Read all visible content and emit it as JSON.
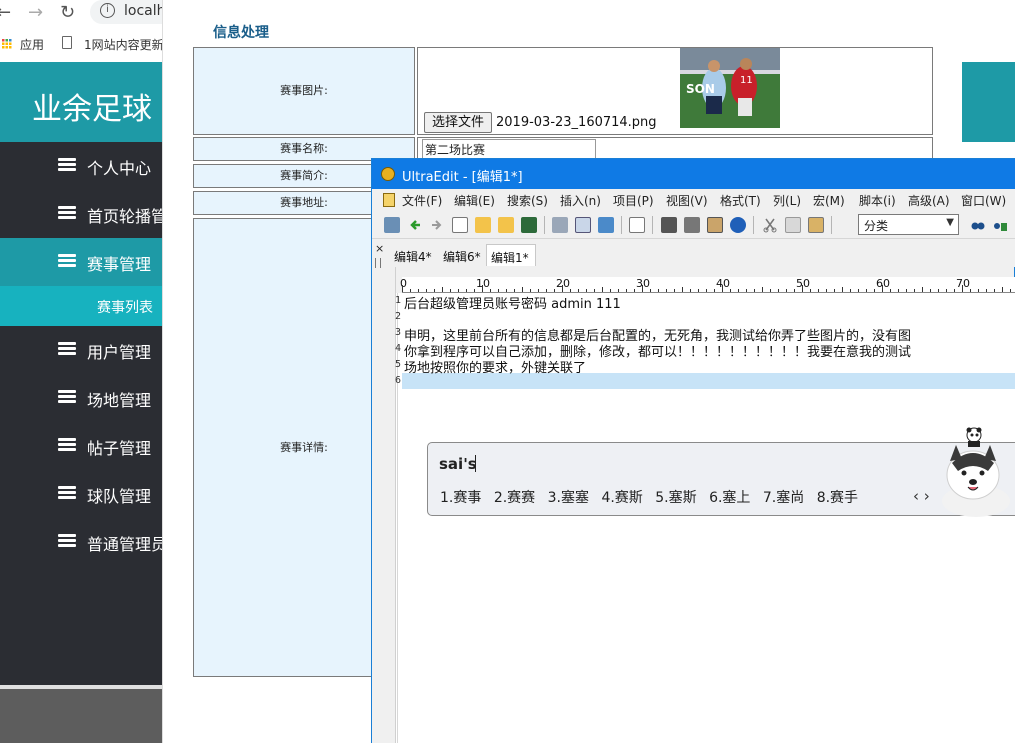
{
  "browser": {
    "url": "localh",
    "bookmarks": [
      {
        "label": "应用"
      },
      {
        "label": "1网站内容更新"
      }
    ]
  },
  "site": {
    "title": "业余足球"
  },
  "sidebar": {
    "items": [
      {
        "label": "个人中心"
      },
      {
        "label": "首页轮播管"
      },
      {
        "label": "赛事管理"
      },
      {
        "label": "用户管理"
      },
      {
        "label": "场地管理"
      },
      {
        "label": "帖子管理"
      },
      {
        "label": "球队管理"
      },
      {
        "label": "普通管理员"
      }
    ],
    "active_index": 2,
    "sub_item": {
      "label": "赛事列表"
    }
  },
  "form": {
    "title": "信息处理",
    "fields": {
      "image": {
        "label": "赛事图片:",
        "button": "选择文件",
        "file_name": "2019-03-23_160714.png"
      },
      "name": {
        "label": "赛事名称:",
        "value": "第二场比赛"
      },
      "intro": {
        "label": "赛事简介:"
      },
      "address": {
        "label": "赛事地址:"
      },
      "details": {
        "label": "赛事详情:"
      }
    }
  },
  "ultraedit": {
    "title": "UltraEdit - [编辑1*]",
    "menu": [
      "文件(F)",
      "编辑(E)",
      "搜索(S)",
      "插入(n)",
      "项目(P)",
      "视图(V)",
      "格式(T)",
      "列(L)",
      "宏(M)",
      "脚本(i)",
      "高级(A)",
      "窗口(W)"
    ],
    "combo": "分类",
    "close_glyph": "×",
    "tabs": [
      {
        "label": "编辑4*"
      },
      {
        "label": "编辑6*"
      },
      {
        "label": "编辑1*"
      }
    ],
    "active_tab": 2,
    "ruler_numbers": [
      "0",
      "10",
      "20",
      "30",
      "40",
      "50",
      "60",
      "70"
    ],
    "lines": [
      {
        "num": "1",
        "text": "后台超级管理员账号密码 admin 111"
      },
      {
        "num": "2",
        "text": ""
      },
      {
        "num": "3",
        "text": "申明，这里前台所有的信息都是后台配置的，无死角，我测试给你弄了些图片的，没有图"
      },
      {
        "num": "4",
        "text": "你拿到程序可以自己添加，删除，修改，都可以！！！！！！！！！！我要在意我的测试"
      },
      {
        "num": "5",
        "text": "场地按照你的要求，外键关联了"
      },
      {
        "num": "6",
        "text": ""
      }
    ]
  },
  "ime": {
    "composition": "sai's",
    "candidates": [
      "1.赛事",
      "2.赛赛",
      "3.塞塞",
      "4.赛斯",
      "5.塞斯",
      "6.塞上",
      "7.塞尚",
      "8.赛手"
    ],
    "arrows": "‹ ›"
  },
  "colors": {
    "accent": "#1e9aa6",
    "sub_accent": "#17b2bf",
    "sidebar_bg": "#2b2d33",
    "ue_title": "#0f7ae5",
    "label_bg": "#e7f4fd"
  }
}
